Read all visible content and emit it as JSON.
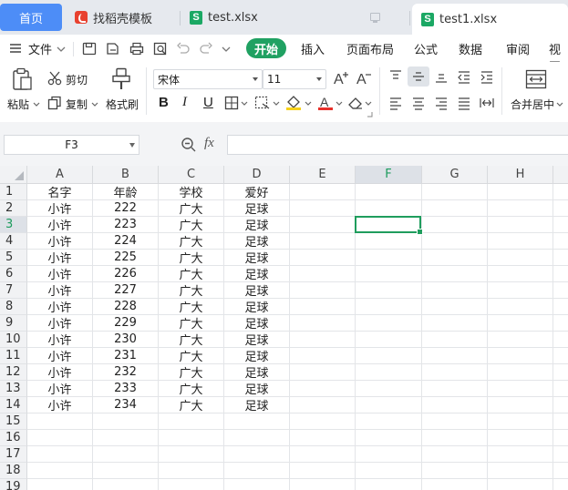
{
  "tabs": {
    "home": "首页",
    "template": "找稻壳模板",
    "file1": "test.xlsx",
    "file2": "test1.xlsx"
  },
  "menu": {
    "file": "文件",
    "items": [
      "开始",
      "插入",
      "页面布局",
      "公式",
      "数据",
      "审阅",
      "视图"
    ]
  },
  "ribbon": {
    "paste": "粘贴",
    "cut": "剪切",
    "copy": "复制",
    "format_painter": "格式刷",
    "font_name": "宋体",
    "font_size": "11",
    "bold": "B",
    "italic": "I",
    "underline": "U",
    "merge_center": "合并居中"
  },
  "formula_bar": {
    "name_box": "F3",
    "fx": "fx",
    "content": ""
  },
  "sheet": {
    "columns": [
      "A",
      "B",
      "C",
      "D",
      "E",
      "F",
      "G",
      "H"
    ],
    "active_column": "F",
    "active_row": "3",
    "rows": [
      {
        "n": "1",
        "cells": [
          "名字",
          "年龄",
          "学校",
          "爱好"
        ]
      },
      {
        "n": "2",
        "cells": [
          "小许",
          "222",
          "广大",
          "足球"
        ]
      },
      {
        "n": "3",
        "cells": [
          "小许",
          "223",
          "广大",
          "足球"
        ]
      },
      {
        "n": "4",
        "cells": [
          "小许",
          "224",
          "广大",
          "足球"
        ]
      },
      {
        "n": "5",
        "cells": [
          "小许",
          "225",
          "广大",
          "足球"
        ]
      },
      {
        "n": "6",
        "cells": [
          "小许",
          "226",
          "广大",
          "足球"
        ]
      },
      {
        "n": "7",
        "cells": [
          "小许",
          "227",
          "广大",
          "足球"
        ]
      },
      {
        "n": "8",
        "cells": [
          "小许",
          "228",
          "广大",
          "足球"
        ]
      },
      {
        "n": "9",
        "cells": [
          "小许",
          "229",
          "广大",
          "足球"
        ]
      },
      {
        "n": "10",
        "cells": [
          "小许",
          "230",
          "广大",
          "足球"
        ]
      },
      {
        "n": "11",
        "cells": [
          "小许",
          "231",
          "广大",
          "足球"
        ]
      },
      {
        "n": "12",
        "cells": [
          "小许",
          "232",
          "广大",
          "足球"
        ]
      },
      {
        "n": "13",
        "cells": [
          "小许",
          "233",
          "广大",
          "足球"
        ]
      },
      {
        "n": "14",
        "cells": [
          "小许",
          "234",
          "广大",
          "足球"
        ]
      },
      {
        "n": "15",
        "cells": []
      },
      {
        "n": "16",
        "cells": []
      },
      {
        "n": "17",
        "cells": []
      },
      {
        "n": "18",
        "cells": []
      },
      {
        "n": "19",
        "cells": []
      }
    ]
  },
  "colors": {
    "accent": "#20a162",
    "home_tab": "#4d8df7",
    "selection": "#1f9d5d"
  }
}
